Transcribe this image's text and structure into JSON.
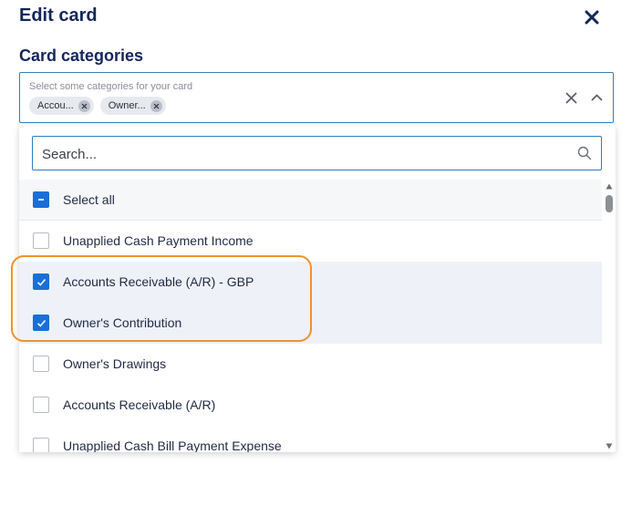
{
  "dialog": {
    "title": "Edit card"
  },
  "field": {
    "label": "Card categories",
    "placeholder": "Select some categories for your card",
    "chips": [
      {
        "label": "Accou..."
      },
      {
        "label": "Owner..."
      }
    ]
  },
  "search": {
    "placeholder": "Search...",
    "value": ""
  },
  "options": [
    {
      "label": "Select all",
      "state": "indeterminate"
    },
    {
      "label": "Unapplied Cash Payment Income",
      "checked": false
    },
    {
      "label": "Accounts Receivable (A/R) - GBP",
      "checked": true
    },
    {
      "label": "Owner's Contribution",
      "checked": true
    },
    {
      "label": "Owner's Drawings",
      "checked": false
    },
    {
      "label": "Accounts Receivable (A/R)",
      "checked": false
    },
    {
      "label": "Unapplied Cash Bill Payment Expense",
      "checked": false
    }
  ],
  "colors": {
    "accent": "#1a6fd6",
    "title": "#14275c",
    "highlight": "#f0922d"
  },
  "icons": {
    "close": "close-icon",
    "clear": "clear-icon",
    "collapse": "chevron-up-icon",
    "search": "search-icon",
    "check": "check-icon",
    "minus": "minus-icon"
  }
}
